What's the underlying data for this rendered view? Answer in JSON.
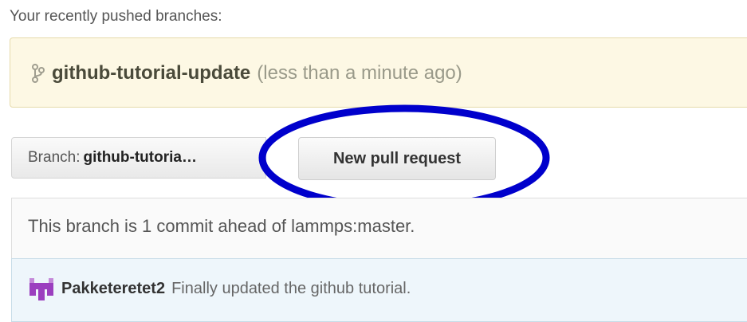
{
  "recent": {
    "label": "Your recently pushed branches:",
    "branch_name": "github-tutorial-update",
    "time_ago": "(less than a minute ago)"
  },
  "branch_selector": {
    "prefix": "Branch:",
    "current": "github-tutoria…"
  },
  "actions": {
    "new_pull_request_label": "New pull request"
  },
  "status": {
    "ahead_text": "This branch is 1 commit ahead of lammps:master."
  },
  "latest_commit": {
    "author": "Pakketeretet2",
    "message": "Finally updated the github tutorial."
  },
  "colors": {
    "annotation_ellipse": "#0000cc",
    "banner_bg": "#fdf8e4",
    "commit_bg": "#eef6fb",
    "avatar": "#9b3fbf"
  },
  "icons": {
    "branch": "git-branch-icon",
    "avatar": "identicon-avatar"
  }
}
